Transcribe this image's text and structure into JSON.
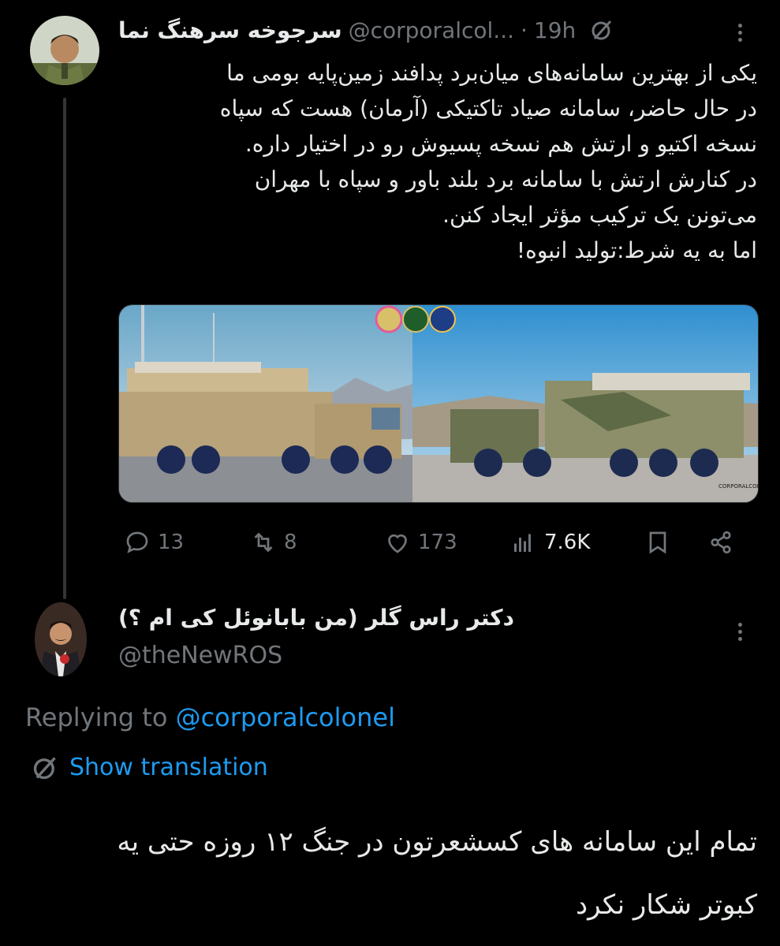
{
  "tweet": {
    "author_name": "سرجوخه سرهنگ نما",
    "handle": "@corporalcol...",
    "separator": "·",
    "time": "19h",
    "text": "یکی از بهترین سامانه‌های میان‌برد پدافند زمین‌پایه بومی ما\nدر حال حاضر، سامانه صیاد تاکتیکی (آرمان) هست که سپاه\nنسخه اکتیو و ارتش هم نسخه پسیوش رو در اختیار داره.\nدر کنارش ارتش با سامانه برد بلند باور و سپاه با مهران\nمی‌تونن یک ترکیب مؤثر ایجاد کنن.\nاما به یه شرط:تولید انبوه!",
    "media_watermark": "CORPORALCOLONEL",
    "stats": {
      "replies": "13",
      "retweets": "8",
      "likes": "173",
      "views": "7.6K"
    }
  },
  "reply": {
    "author_name": "دکتر راس گلر (من بابانوئل کی ام ؟)",
    "handle": "@theNewROS",
    "replying_prefix": "Replying to ",
    "replying_to": "@corporalcolonel",
    "translate_label": "Show translation",
    "text": "تمام این سامانه های کسشعرتون در جنگ ۱۲ روزه حتی یه\nکبوتر شکار نکرد"
  },
  "icons": {
    "grok": "grok-icon",
    "more": "more-icon",
    "reply": "reply-icon",
    "retweet": "retweet-icon",
    "like": "like-icon",
    "views": "views-icon",
    "bookmark": "bookmark-icon",
    "share": "share-icon",
    "translate": "translate-icon"
  },
  "colors": {
    "background": "#000000",
    "text": "#e7e9ea",
    "muted": "#71767b",
    "link": "#1d9bf0"
  }
}
